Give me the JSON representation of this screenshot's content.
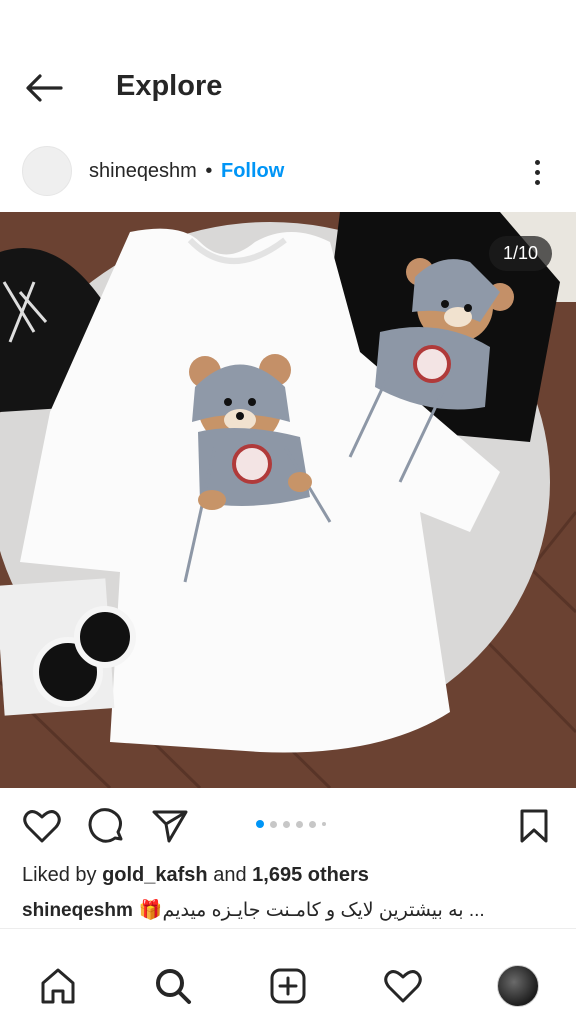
{
  "header": {
    "title": "Explore",
    "back_icon": "arrow-left-icon"
  },
  "post": {
    "username": "shineqeshm",
    "separator": "•",
    "follow_label": "Follow",
    "more_icon": "more-vertical-icon",
    "image_counter": "1/10",
    "image_description_icon": "photo-tshirts-teddy-bear",
    "carousel": {
      "total_dots": 6,
      "active_index": 0
    }
  },
  "actions": {
    "like_icon": "heart-icon",
    "comment_icon": "comment-icon",
    "share_icon": "send-icon",
    "save_icon": "bookmark-icon"
  },
  "likes": {
    "prefix": "Liked by",
    "user": "gold_kafsh",
    "middle": "and",
    "others": "1,695 others"
  },
  "caption": {
    "username": "shineqeshm",
    "text": "🎁به بیشترین لایک و کامـنت جایـزه میدیم ..."
  },
  "bottom_nav": {
    "items": [
      "home-icon",
      "search-icon",
      "new-post-icon",
      "activity-heart-icon",
      "profile-avatar"
    ]
  },
  "colors": {
    "accent": "#0095f6",
    "text": "#262626",
    "muted": "#c7c7c7"
  }
}
